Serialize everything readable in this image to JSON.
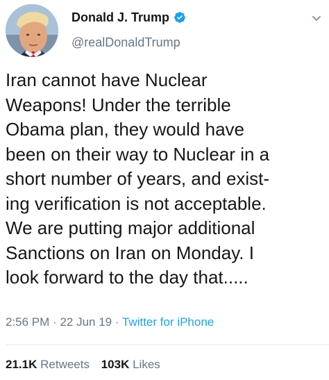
{
  "user": {
    "display_name": "Donald J. Trump",
    "handle": "@realDonaldTrump",
    "verified_color": "#1da1f2"
  },
  "tweet": {
    "lines": [
      "Iran cannot have Nuclear",
      "Weapons! Under the terrible",
      "Obama plan, they would have",
      "been on their way to Nuclear in a",
      "short number of years, and exist-",
      "ing verification is not acceptable.",
      "We are putting major additional",
      "Sanctions on Iran on Monday. I",
      "look forward to the day that....."
    ]
  },
  "meta": {
    "time": "2:56 PM",
    "date": "22 Jun 19",
    "separator": "·",
    "source": "Twitter for iPhone"
  },
  "stats": {
    "retweets_count": "21.1K",
    "retweets_label": "Retweets",
    "likes_count": "103K",
    "likes_label": "Likes"
  },
  "icons": {
    "verified": "verified-badge-icon",
    "menu": "chevron-down-icon"
  },
  "colors": {
    "text": "#14171a",
    "secondary": "#657786",
    "link": "#1da1f2",
    "divider": "#e1e8ed"
  }
}
